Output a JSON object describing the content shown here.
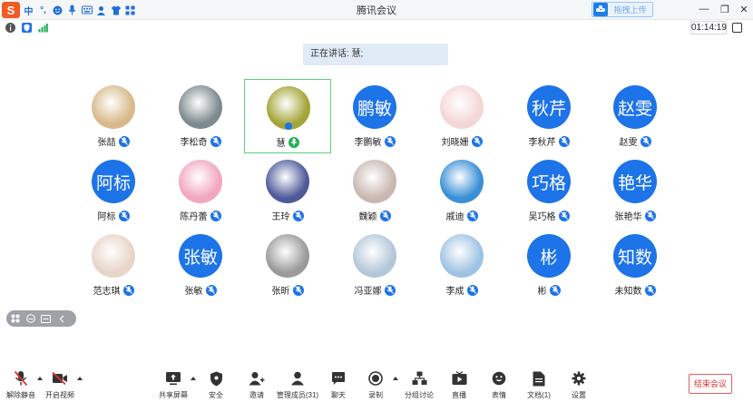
{
  "ime": {
    "logo": "S",
    "mode": "中",
    "punct": "°,",
    "emoji_icon": "smile-icon",
    "voice_icon": "microphone-icon",
    "keyboard_icon": "keyboard-icon",
    "user_icon": "user-icon",
    "skin_icon": "shirt-icon",
    "apps_icon": "grid-icon"
  },
  "window": {
    "title": "腾讯会议",
    "upload_label": "拖拽上传",
    "minimize": "—",
    "restore": "❐",
    "close": "✕"
  },
  "status": {
    "timer": "01:14:19"
  },
  "speaking_banner": "正在讲话: 慧;",
  "participants": [
    {
      "name": "张喆",
      "initials": "",
      "avatar_color": "#d8b98a"
    },
    {
      "name": "李松奇",
      "initials": "",
      "avatar_color": "#7d8a8e"
    },
    {
      "name": "慧",
      "initials": "",
      "avatar_color": "#a4a438"
    },
    {
      "name": "李鹏敏",
      "initials": "鹏敏",
      "avatar_color": "#1d73e8"
    },
    {
      "name": "刘晓姗",
      "initials": "",
      "avatar_color": "#f4d6d6"
    },
    {
      "name": "李秋芹",
      "initials": "秋芹",
      "avatar_color": "#1d73e8"
    },
    {
      "name": "赵雯",
      "initials": "赵雯",
      "avatar_color": "#1d73e8"
    },
    {
      "name": "阿标",
      "initials": "阿标",
      "avatar_color": "#1d73e8"
    },
    {
      "name": "陈丹蕾",
      "initials": "",
      "avatar_color": "#f2a6c0"
    },
    {
      "name": "王玲",
      "initials": "",
      "avatar_color": "#4f5a9a"
    },
    {
      "name": "魏颖",
      "initials": "",
      "avatar_color": "#c9b8b0"
    },
    {
      "name": "戚迪",
      "initials": "",
      "avatar_color": "#3a8fd6"
    },
    {
      "name": "吴巧格",
      "initials": "巧格",
      "avatar_color": "#1d73e8"
    },
    {
      "name": "张艳华",
      "initials": "艳华",
      "avatar_color": "#1d73e8"
    },
    {
      "name": "范志琪",
      "initials": "",
      "avatar_color": "#e8d4c8"
    },
    {
      "name": "张敏",
      "initials": "张敏",
      "avatar_color": "#1d73e8"
    },
    {
      "name": "张昕",
      "initials": "",
      "avatar_color": "#9a9a9a"
    },
    {
      "name": "冯亚娜",
      "initials": "",
      "avatar_color": "#b4c7d9"
    },
    {
      "name": "李成",
      "initials": "",
      "avatar_color": "#9fc3e3"
    },
    {
      "name": "彬",
      "initials": "彬",
      "avatar_color": "#1d73e8"
    },
    {
      "name": "未知数",
      "initials": "知数",
      "avatar_color": "#1d73e8"
    }
  ],
  "toolbar": {
    "unmute": "解除静音",
    "start_video": "开启视频",
    "share_screen": "共享屏幕",
    "security": "安全",
    "invite": "邀请",
    "members": "管理成员(31)",
    "chat": "聊天",
    "record": "录制",
    "breakout": "分组讨论",
    "live": "直播",
    "reaction": "表情",
    "docs": "文档(1)",
    "settings": "设置",
    "end_meeting": "结束会议"
  },
  "colors": {
    "accent": "#1d73e8",
    "speaking": "#1fae52",
    "danger": "#d9342c"
  }
}
